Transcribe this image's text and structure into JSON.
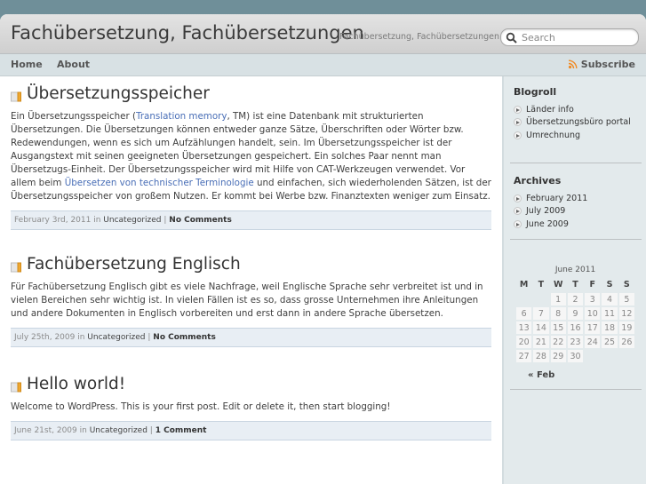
{
  "header": {
    "site_title": "Fachübersetzung, Fachübersetzungen",
    "site_description": "Fachübersetzung, Fachübersetzungen",
    "search": {
      "placeholder": "Search",
      "value": "",
      "icon": "search-icon"
    }
  },
  "nav": {
    "items": [
      {
        "label": "Home"
      },
      {
        "label": "About"
      }
    ],
    "subscribe": {
      "label": "Subscribe",
      "icon": "rss-icon"
    }
  },
  "posts": [
    {
      "title": "Übersetzungsspeicher",
      "icon": "post-icon",
      "body": {
        "t1": "Ein Übersetzungsspeicher (",
        "link1": "Translation memory",
        "t2": ", TM) ist eine Datenbank mit strukturierten Übersetzungen. Die Übersetzungen können entweder ganze Sätze, Überschriften oder Wörter bzw. Redewendungen, wenn es sich um Aufzählungen handelt, sein. Im Übersetzungsspeicher ist der Ausgangstext mit seinen geeigneten Übersetzungen gespeichert. Ein solches Paar nennt man Übersetzugs-Einheit. Der Übersetzungsspeicher wird mit Hilfe von CAT-Werkzeugen verwendet. Vor allem beim ",
        "link2": "Übersetzen von technischer Terminologie",
        "t3": " und einfachen, sich wiederholenden Sätzen, ist der Übersetzungsspeicher von großem Nutzen. Er kommt bei Werbe bzw. Finanztexten weniger zum Einsatz."
      },
      "meta": {
        "date": "February 3rd, 2011",
        "in": " in ",
        "category": "Uncategorized",
        "sep": " | ",
        "comments": "No Comments"
      }
    },
    {
      "title": "Fachübersetzung Englisch",
      "icon": "post-icon",
      "body": {
        "t1": "Für Fachübersetzung Englisch gibt es viele Nachfrage, weil Englische Sprache sehr verbreitet ist und in vielen Bereichen sehr wichtig ist. In vielen Fällen ist es so, dass grosse Unternehmen ihre Anleitungen und andere Dokumenten in Englisch vorbereiten und erst dann in andere Sprache übersetzen."
      },
      "meta": {
        "date": "July 25th, 2009",
        "in": " in ",
        "category": "Uncategorized",
        "sep": " | ",
        "comments": "No Comments"
      }
    },
    {
      "title": "Hello world!",
      "icon": "post-icon",
      "body": {
        "t1": "Welcome to WordPress. This is your first post. Edit or delete it, then start blogging!"
      },
      "meta": {
        "date": "June 21st, 2009",
        "in": " in ",
        "category": "Uncategorized",
        "sep": " | ",
        "comments": "1 Comment"
      }
    }
  ],
  "sidebar": {
    "blogroll": {
      "title": "Blogroll",
      "items": [
        {
          "label": "Länder info"
        },
        {
          "label": "Übersetzungsbüro portal"
        },
        {
          "label": "Umrechnung"
        }
      ]
    },
    "archives": {
      "title": "Archives",
      "items": [
        {
          "label": "February 2011"
        },
        {
          "label": "July 2009"
        },
        {
          "label": "June 2009"
        }
      ]
    },
    "calendar": {
      "caption": "June 2011",
      "weekdays": [
        "M",
        "T",
        "W",
        "T",
        "F",
        "S",
        "S"
      ],
      "weeks": [
        [
          "",
          "",
          "1",
          "2",
          "3",
          "4",
          "5"
        ],
        [
          "6",
          "7",
          "8",
          "9",
          "10",
          "11",
          "12"
        ],
        [
          "13",
          "14",
          "15",
          "16",
          "17",
          "18",
          "19"
        ],
        [
          "20",
          "21",
          "22",
          "23",
          "24",
          "25",
          "26"
        ],
        [
          "27",
          "28",
          "29",
          "30",
          "",
          "",
          ""
        ]
      ],
      "prev_link": "« Feb"
    }
  }
}
